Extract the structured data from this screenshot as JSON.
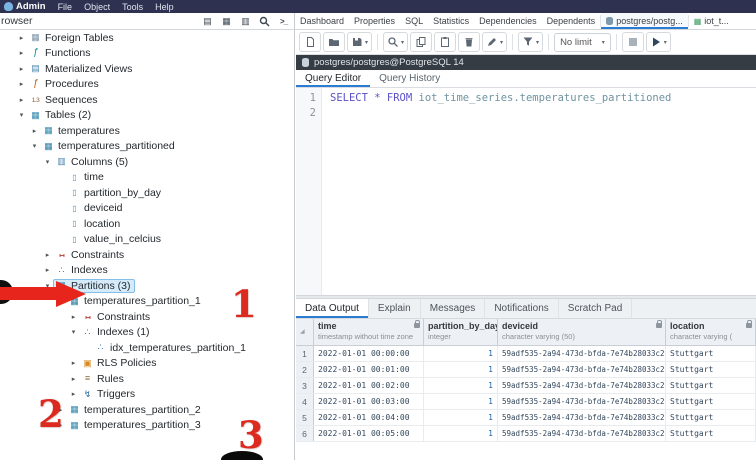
{
  "app": {
    "logo": "Admin",
    "menus": [
      "File",
      "Object",
      "Tools",
      "Help"
    ]
  },
  "browser": {
    "title": "rowser",
    "terminal_glyph": ">_",
    "icons": [
      "storage-icon",
      "grid-icon",
      "layout-icon",
      "search-icon",
      "terminal-icon"
    ]
  },
  "tree": {
    "items": [
      {
        "arrow": "▸",
        "label": "Foreign Tables"
      },
      {
        "arrow": "▸",
        "label": "Functions"
      },
      {
        "arrow": "▸",
        "label": "Materialized Views"
      },
      {
        "arrow": "▸",
        "label": "Procedures"
      },
      {
        "arrow": "▸",
        "label": "Sequences"
      },
      {
        "arrow": "▾",
        "label": "Tables (2)"
      },
      {
        "arrow": "▸",
        "label": "temperatures"
      },
      {
        "arrow": "▾",
        "label": "temperatures_partitioned"
      },
      {
        "arrow": "▾",
        "label": "Columns (5)"
      },
      {
        "arrow": "",
        "label": "time"
      },
      {
        "arrow": "",
        "label": "partition_by_day"
      },
      {
        "arrow": "",
        "label": "deviceid"
      },
      {
        "arrow": "",
        "label": "location"
      },
      {
        "arrow": "",
        "label": "value_in_celcius"
      },
      {
        "arrow": "▸",
        "label": "Constraints"
      },
      {
        "arrow": "▸",
        "label": "Indexes"
      },
      {
        "arrow": "▾",
        "label": "Partitions (3)"
      },
      {
        "arrow": "▾",
        "label": "temperatures_partition_1"
      },
      {
        "arrow": "▸",
        "label": "Constraints"
      },
      {
        "arrow": "▾",
        "label": "Indexes (1)"
      },
      {
        "arrow": "",
        "label": "idx_temperatures_partition_1"
      },
      {
        "arrow": "▸",
        "label": "RLS Policies"
      },
      {
        "arrow": "▸",
        "label": "Rules"
      },
      {
        "arrow": "▸",
        "label": "Triggers"
      },
      {
        "arrow": "▸",
        "label": "temperatures_partition_2"
      },
      {
        "arrow": "▸",
        "label": "temperatures_partition_3"
      }
    ]
  },
  "main_tabs": {
    "items": [
      "Dashboard",
      "Properties",
      "SQL",
      "Statistics",
      "Dependencies",
      "Dependents"
    ],
    "query_tab": "postgres/postg...",
    "table_tab": "iot_t..."
  },
  "toolbar": {
    "limit": "No limit",
    "icons": [
      "open-file",
      "folder",
      "save",
      "find",
      "copy",
      "paste",
      "delete",
      "edit",
      "filter",
      "cancel",
      "execute"
    ]
  },
  "connection": {
    "label": "postgres/postgres@PostgreSQL 14"
  },
  "query_tabs": {
    "items": [
      "Query Editor",
      "Query History"
    ],
    "active": "Query Editor"
  },
  "editor": {
    "line_numbers": [
      "1",
      "2"
    ],
    "keywords": "SELECT * FROM ",
    "identifier": "iot_time_series.temperatures_partitioned"
  },
  "output": {
    "tabs": [
      "Data Output",
      "Explain",
      "Messages",
      "Notifications",
      "Scratch Pad"
    ],
    "active": "Data Output"
  },
  "grid": {
    "columns": [
      {
        "name": "time",
        "type": "timestamp without time zone"
      },
      {
        "name": "partition_by_day",
        "type": "integer"
      },
      {
        "name": "deviceid",
        "type": "character varying (50)"
      },
      {
        "name": "location",
        "type": "character varying ("
      }
    ],
    "rows": [
      {
        "n": "1",
        "time": "2022-01-01 00:00:00",
        "day": "1",
        "deviceid": "59adf535-2a94-473d-bfda-7e74b28033c2",
        "location": "Stuttgart"
      },
      {
        "n": "2",
        "time": "2022-01-01 00:01:00",
        "day": "1",
        "deviceid": "59adf535-2a94-473d-bfda-7e74b28033c2",
        "location": "Stuttgart"
      },
      {
        "n": "3",
        "time": "2022-01-01 00:02:00",
        "day": "1",
        "deviceid": "59adf535-2a94-473d-bfda-7e74b28033c2",
        "location": "Stuttgart"
      },
      {
        "n": "4",
        "time": "2022-01-01 00:03:00",
        "day": "1",
        "deviceid": "59adf535-2a94-473d-bfda-7e74b28033c2",
        "location": "Stuttgart"
      },
      {
        "n": "5",
        "time": "2022-01-01 00:04:00",
        "day": "1",
        "deviceid": "59adf535-2a94-473d-bfda-7e74b28033c2",
        "location": "Stuttgart"
      },
      {
        "n": "6",
        "time": "2022-01-01 00:05:00",
        "day": "1",
        "deviceid": "59adf535-2a94-473d-bfda-7e74b28033c2",
        "location": "Stuttgart"
      }
    ]
  },
  "annotations": {
    "n1": "1",
    "n2": "2",
    "n3": "3"
  }
}
